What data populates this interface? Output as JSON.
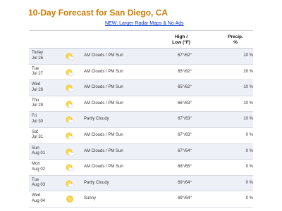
{
  "page": {
    "title": "10-Day Forecast for San Diego, CA",
    "promo_link": "NEW: Larger Radar Maps & No Ads"
  },
  "table": {
    "headers": {
      "high_low_line1": "High /",
      "high_low_line2": "Low (°F)",
      "precip_line1": "Precip.",
      "precip_line2": "%"
    },
    "rows": [
      {
        "day": "Today",
        "date": "Jul 26",
        "icon": "partly-sunny-icon",
        "condition": "AM Clouds / PM Sun",
        "temps": "67°/62°",
        "precip": "10 %"
      },
      {
        "day": "Tue",
        "date": "Jul 27",
        "icon": "partly-sunny-icon",
        "condition": "AM Clouds / PM Sun",
        "temps": "65°/62°",
        "precip": "20 %"
      },
      {
        "day": "Wed",
        "date": "Jul 28",
        "icon": "partly-sunny-icon",
        "condition": "AM Clouds / PM Sun",
        "temps": "65°/62°",
        "precip": "10 %"
      },
      {
        "day": "Thu",
        "date": "Jul 29",
        "icon": "partly-sunny-icon",
        "condition": "AM Clouds / PM Sun",
        "temps": "66°/63°",
        "precip": "10 %"
      },
      {
        "day": "Fri",
        "date": "Jul 30",
        "icon": "partly-sunny-icon",
        "condition": "Partly Cloudy",
        "temps": "67°/63°",
        "precip": "10 %"
      },
      {
        "day": "Sat",
        "date": "Jul 31",
        "icon": "partly-sunny-icon",
        "condition": "AM Clouds / PM Sun",
        "temps": "67°/63°",
        "precip": "0 %"
      },
      {
        "day": "Sun",
        "date": "Aug 01",
        "icon": "partly-sunny-icon",
        "condition": "AM Clouds / PM Sun",
        "temps": "67°/64°",
        "precip": "0 %"
      },
      {
        "day": "Mon",
        "date": "Aug 02",
        "icon": "partly-sunny-icon",
        "condition": "AM Clouds / PM Sun",
        "temps": "68°/65°",
        "precip": "0 %"
      },
      {
        "day": "Tue",
        "date": "Aug 03",
        "icon": "partly-sunny-icon",
        "condition": "Partly Cloudy",
        "temps": "69°/64°",
        "precip": "0 %"
      },
      {
        "day": "Wed",
        "date": "Aug 04",
        "icon": "sun-icon",
        "condition": "Sunny",
        "temps": "69°/64°",
        "precip": "0 %"
      }
    ]
  }
}
